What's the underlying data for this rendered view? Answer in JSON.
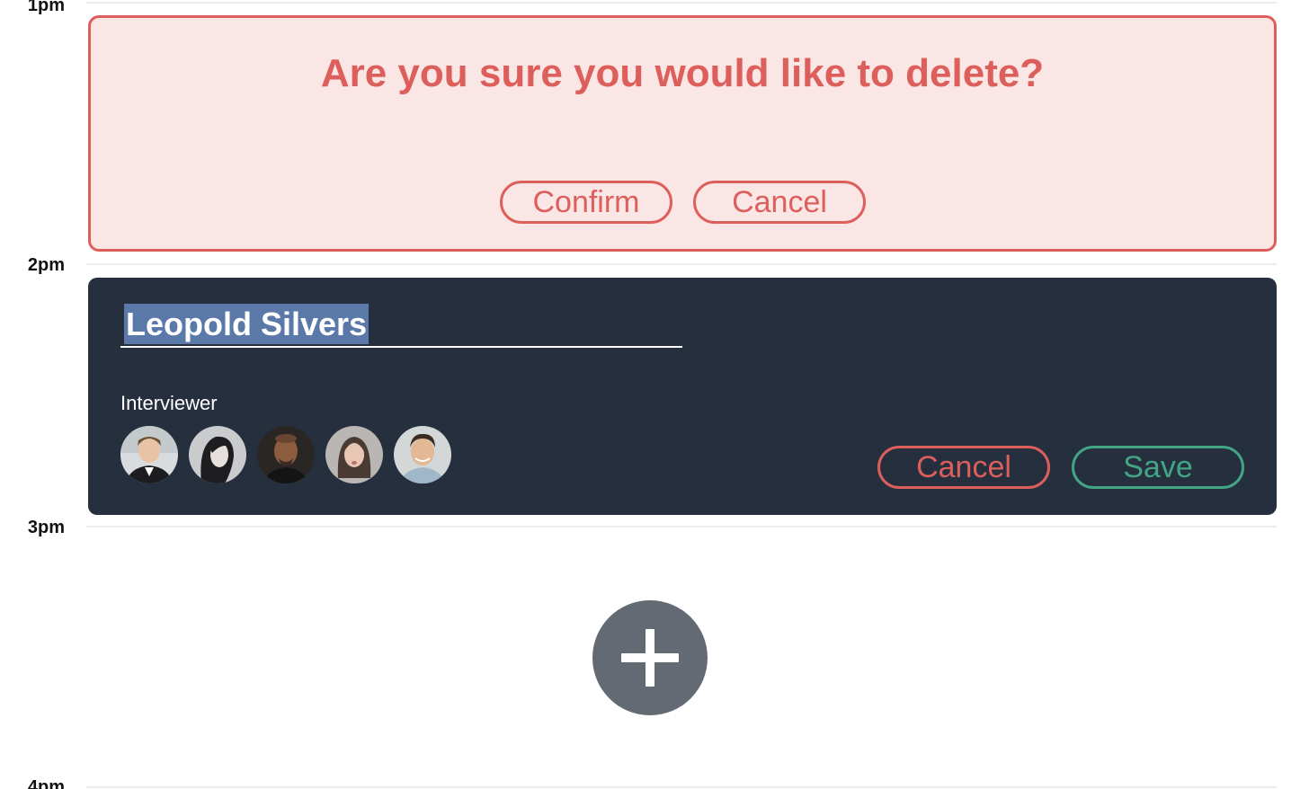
{
  "timeline": {
    "hours": [
      "1pm",
      "2pm",
      "3pm",
      "4pm"
    ]
  },
  "delete_confirm": {
    "question": "Are you sure you would like to delete?",
    "confirm_label": "Confirm",
    "cancel_label": "Cancel",
    "accent_color": "#dd5f5b"
  },
  "edit_event": {
    "name_value": "Leopold Silvers",
    "interviewer_label": "Interviewer",
    "avatars": [
      "avatar-1",
      "avatar-2",
      "avatar-3",
      "avatar-4",
      "avatar-5"
    ],
    "cancel_label": "Cancel",
    "save_label": "Save",
    "background_color": "#262f3e",
    "save_color": "#42a583"
  },
  "add_button": {
    "icon": "plus-icon",
    "color": "#636a74"
  }
}
